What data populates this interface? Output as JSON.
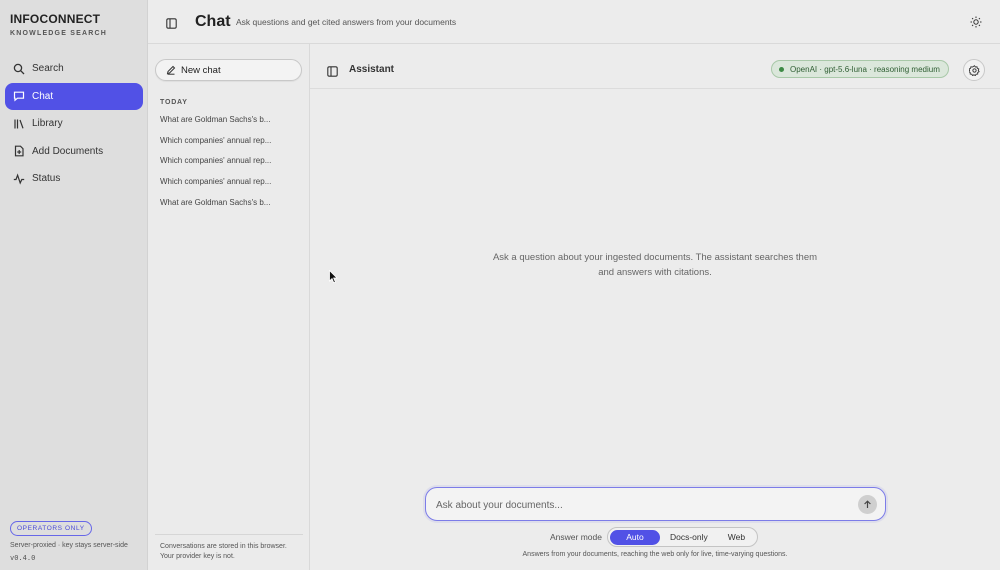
{
  "brand": {
    "title": "INFOCONNECT",
    "subtitle": "KNOWLEDGE SEARCH"
  },
  "nav": {
    "items": [
      {
        "label": "Search",
        "icon": "search-icon"
      },
      {
        "label": "Chat",
        "icon": "chat-bubble-icon",
        "active": true
      },
      {
        "label": "Library",
        "icon": "library-icon"
      },
      {
        "label": "Add Documents",
        "icon": "add-document-icon"
      },
      {
        "label": "Status",
        "icon": "activity-icon"
      }
    ],
    "badge": "OPERATORS ONLY",
    "footer_note": "Server-proxied · key stays server-side",
    "version": "v0.4.0"
  },
  "header": {
    "title": "Chat",
    "subtitle": "Ask questions and get cited answers from your documents"
  },
  "history": {
    "new_chat_label": "New chat",
    "section_label": "TODAY",
    "items": [
      "What are Goldman Sachs's b...",
      "Which companies' annual rep...",
      "Which companies' annual rep...",
      "Which companies' annual rep...",
      "What are Goldman Sachs's b..."
    ],
    "note": "Conversations are stored in this browser. Your provider key is not."
  },
  "assistant": {
    "label": "Assistant",
    "model_status": "OpenAI · gpt-5.6-luna · reasoning medium",
    "empty_message": "Ask a question about your ingested documents. The assistant searches them and answers with citations."
  },
  "composer": {
    "placeholder": "Ask about your documents...",
    "value": ""
  },
  "answer_mode": {
    "label": "Answer mode",
    "options": [
      "Auto",
      "Docs-only",
      "Web"
    ],
    "selected": "Auto",
    "hint": "Answers from your documents, reaching the web only for live, time-varying questions."
  },
  "colors": {
    "accent": "#5151e6",
    "status_green": "#3d8a45"
  }
}
